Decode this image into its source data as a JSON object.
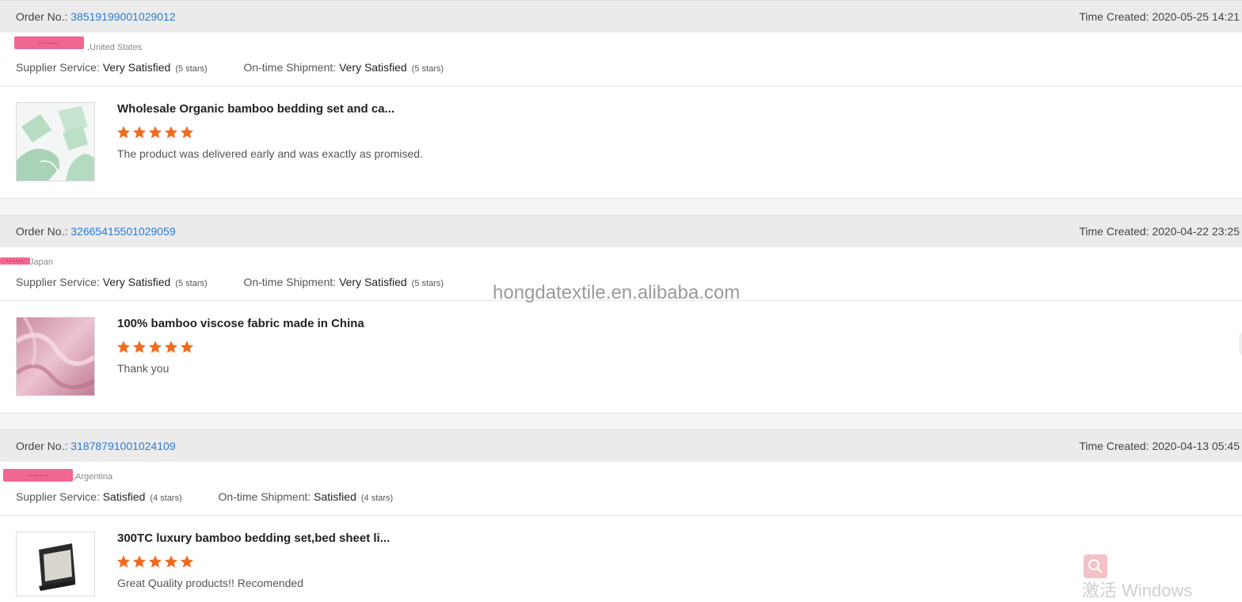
{
  "labels": {
    "order_no": "Order No.: ",
    "time_created": "Time Created: ",
    "supplier_service": "Supplier Service: ",
    "ontime_shipment": "On-time Shipment: "
  },
  "orders": [
    {
      "order_number": "38519199001029012",
      "time_created": "2020-05-25 14:21",
      "buyer_mask": ".......",
      "buyer_country": ",United States",
      "supplier_rating": "Very Satisfied",
      "supplier_stars": "(5 stars)",
      "shipment_rating": "Very Satisfied",
      "shipment_stars": "(5 stars)",
      "product_title": "Wholesale Organic bamboo bedding set and ca...",
      "star_count": 5,
      "comment": "The product was delivered early and was exactly as promised."
    },
    {
      "order_number": "32665415501029059",
      "time_created": "2020-04-22 23:25",
      "buyer_mask": "......",
      "buyer_country": "Japan",
      "supplier_rating": "Very Satisfied",
      "supplier_stars": "(5 stars)",
      "shipment_rating": "Very Satisfied",
      "shipment_stars": "(5 stars)",
      "product_title": "100% bamboo viscose fabric made in China",
      "star_count": 5,
      "comment": "Thank you"
    },
    {
      "order_number": "31878791001024109",
      "time_created": "2020-04-13 05:45",
      "buyer_mask": ".......",
      "buyer_country": ",Argentina",
      "supplier_rating": "Satisfied",
      "supplier_stars": "(4 stars)",
      "shipment_rating": "Satisfied",
      "shipment_stars": "(4 stars)",
      "product_title": "300TC luxury bamboo bedding set,bed sheet li...",
      "star_count": 5,
      "comment": "Great Quality products!! Recomended"
    }
  ],
  "watermark": "HONGDATEXTILE.en.alibaba.com",
  "watermark_display": "hongdatextile.en.alibaba.com",
  "os_overlay_text": "激活 Windows",
  "colors": {
    "link": "#2a7bd4",
    "star": "#f26b1d",
    "mask": "#f0678f",
    "header_bg": "#ebebeb"
  },
  "icons": {
    "star": "star-icon",
    "search": "search-icon"
  }
}
